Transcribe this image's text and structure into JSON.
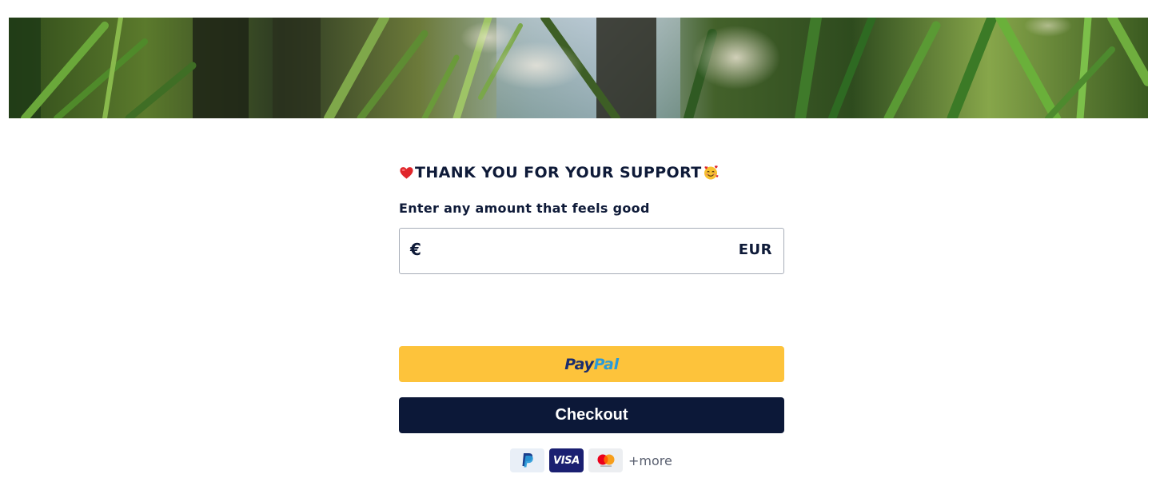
{
  "banner": {
    "image": "jungle-foliage-photo"
  },
  "form": {
    "headline": "THANK YOU FOR YOUR SUPPORT",
    "headline_prefix_icon": "red-heart-icon",
    "headline_suffix_icon": "smiling-face-with-hearts-icon",
    "amount_label": "Enter any amount that feels good",
    "amount_field": {
      "currency_symbol": "€",
      "value": "",
      "placeholder": "",
      "currency_code": "EUR"
    }
  },
  "buttons": {
    "paypal": {
      "logo_part1": "Pay",
      "logo_part2": "Pal",
      "color": "#fdc33b"
    },
    "checkout": {
      "label": "Checkout",
      "color": "#0c1838"
    }
  },
  "payment_methods": {
    "icons": [
      "paypal-icon",
      "visa-icon",
      "mastercard-icon"
    ],
    "visa_text": "VISA",
    "more_label": "+more"
  }
}
